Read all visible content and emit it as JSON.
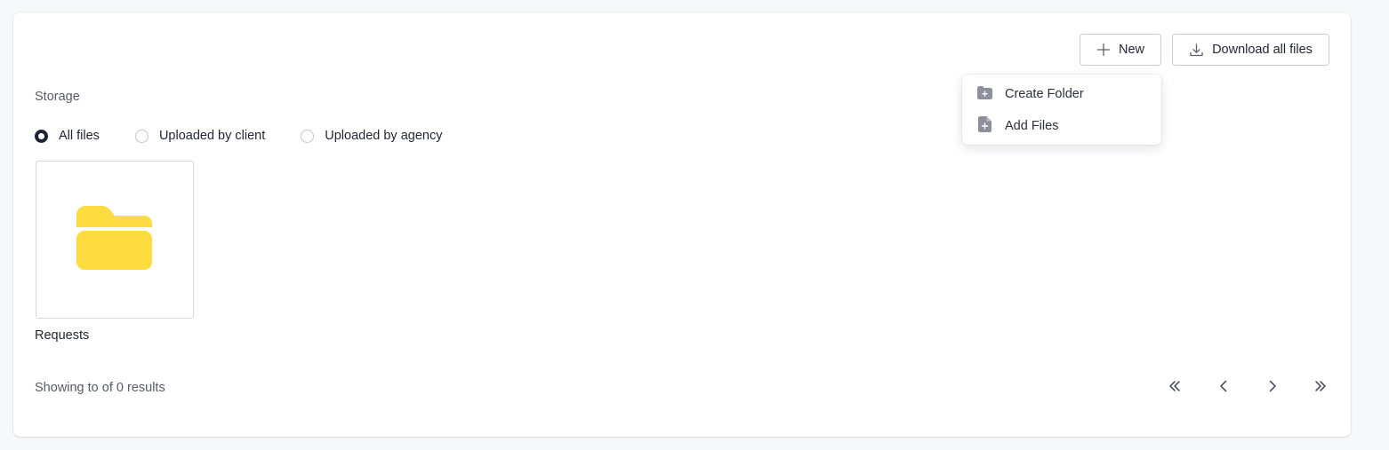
{
  "toolbar": {
    "new_label": "New",
    "download_label": "Download all files"
  },
  "storage": {
    "label": "Storage",
    "filters": [
      {
        "label": "All files",
        "checked": true
      },
      {
        "label": "Uploaded by client",
        "checked": false
      },
      {
        "label": "Uploaded by agency",
        "checked": false
      }
    ]
  },
  "files": [
    {
      "name": "Requests",
      "type": "folder",
      "icon": "folder-icon",
      "color": "#fddc3f"
    }
  ],
  "pagination": {
    "summary": "Showing to of 0 results"
  },
  "new_menu": {
    "items": [
      {
        "label": "Create Folder",
        "icon": "folder-plus-icon"
      },
      {
        "label": "Add Files",
        "icon": "file-plus-icon"
      }
    ]
  },
  "colors": {
    "accent": "#1e2235",
    "folder": "#fddc3f",
    "menu_icon": "#8b909a"
  }
}
